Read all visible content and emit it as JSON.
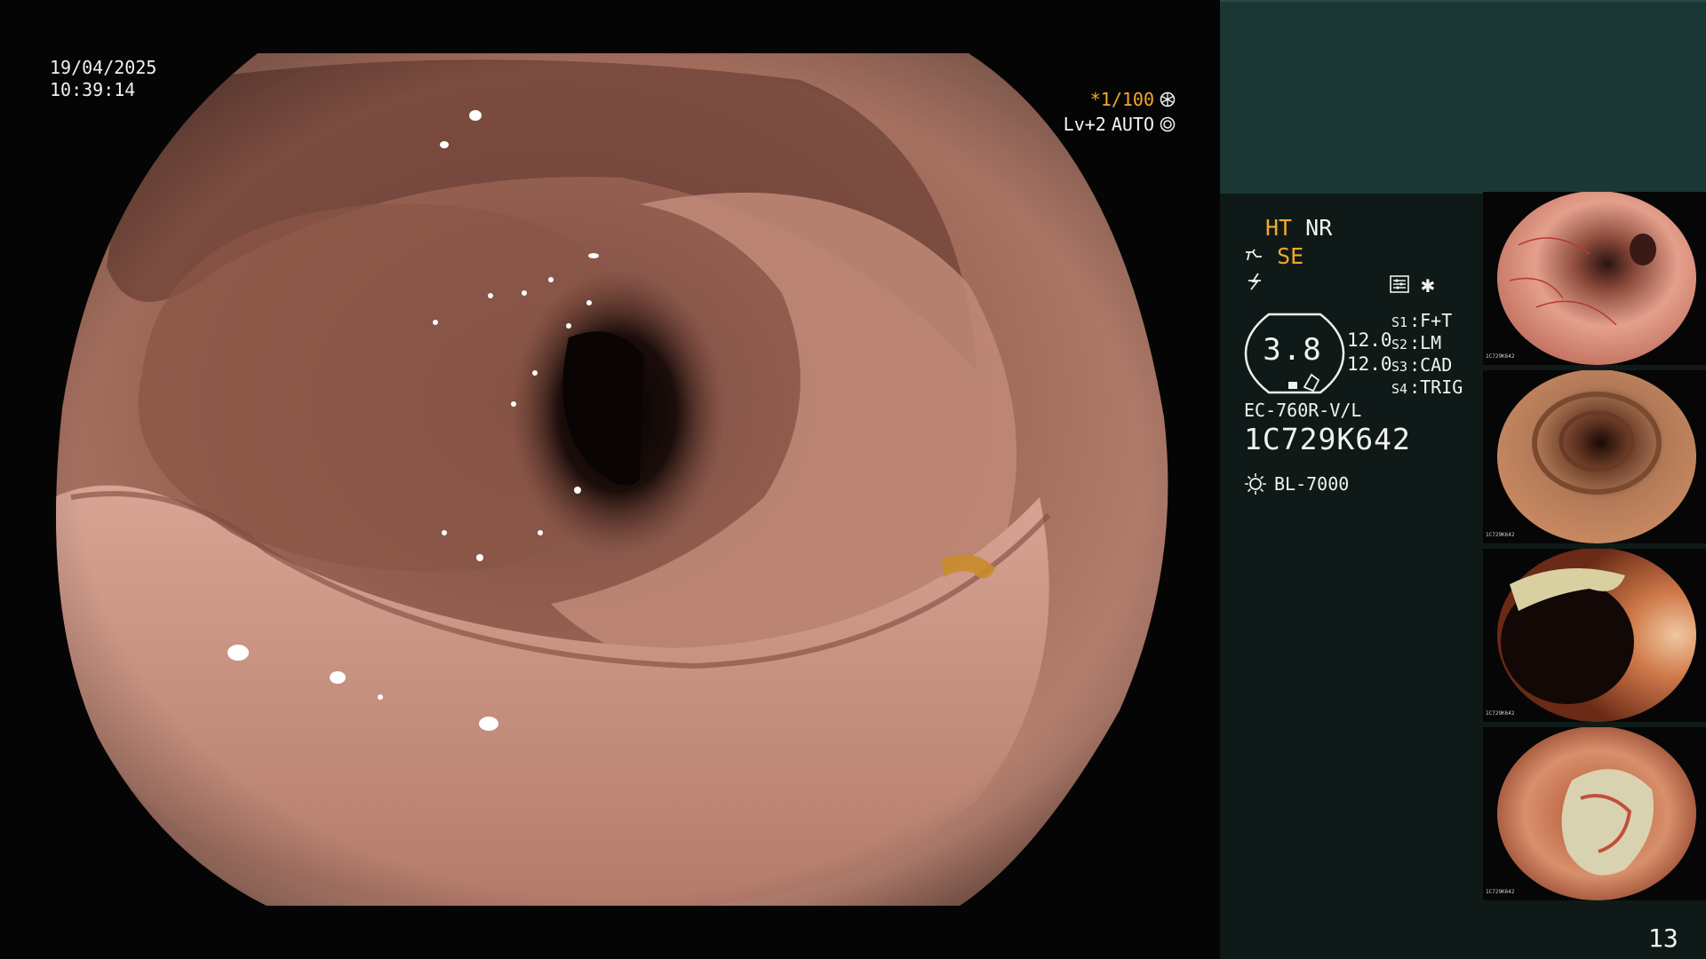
{
  "scope_view": {
    "date": "19/04/2025",
    "time": "10:39:14",
    "shutter": "*1/100",
    "level": "Lv+2",
    "iris_mode": "AUTO"
  },
  "panel": {
    "mode_ht": "HT",
    "mode_nr": "NR",
    "mode_se": "SE",
    "gauge_value": "3.8",
    "gauge_top": "12.0",
    "gauge_bottom": "12.0",
    "switches": [
      {
        "key": "S1",
        "value": "F+T"
      },
      {
        "key": "S2",
        "value": "LM"
      },
      {
        "key": "S3",
        "value": "CAD"
      },
      {
        "key": "S4",
        "value": "TRIG"
      }
    ],
    "scope_model": "EC-760R-V/L",
    "serial_number": "1C729K642",
    "light_source": "BL-7000",
    "thumbnail_id": "1C729K642",
    "page_number": "13"
  },
  "colors": {
    "accent_orange": "#f3a92a",
    "panel_dark": "#0f1a18",
    "panel_teal": "#1b3734"
  },
  "icons": {
    "shutter": "aperture-icon",
    "iris": "iris-icon",
    "structure_enhance": "enhance-icon",
    "flash": "flash-icon",
    "settings": "settings-list-icon",
    "light": "lamp-icon"
  }
}
